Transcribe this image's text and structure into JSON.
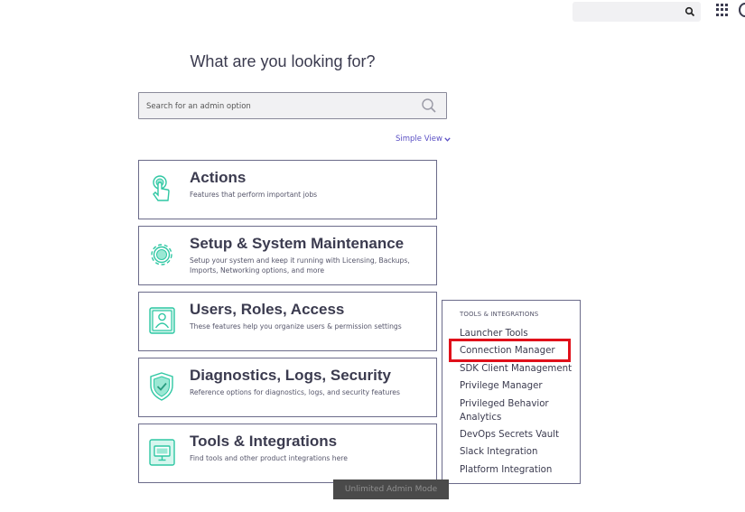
{
  "topbar": {
    "search_icon": "search-icon",
    "apps_icon": "apps-grid-icon"
  },
  "main": {
    "heading": "What are you looking for?",
    "search": {
      "placeholder": "Search for an admin option",
      "value": ""
    },
    "view_toggle": {
      "label": "Simple View"
    }
  },
  "cards": [
    {
      "title": "Actions",
      "description": "Features that perform important jobs",
      "icon": "hand-tap-icon"
    },
    {
      "title": "Setup & System Maintenance",
      "description": "Setup your system and keep it running with Licensing, Backups, Imports, Networking options, and more",
      "icon": "gear-icon"
    },
    {
      "title": "Users, Roles, Access",
      "description": "These features help you organize users & permission settings",
      "icon": "user-badge-icon"
    },
    {
      "title": "Diagnostics, Logs, Security",
      "description": "Reference options for diagnostics, logs, and security features",
      "icon": "shield-check-icon"
    },
    {
      "title": "Tools & Integrations",
      "description": "Find tools and other product integrations here",
      "icon": "monitor-icon"
    }
  ],
  "flyout": {
    "heading": "TOOLS & INTEGRATIONS",
    "items": [
      {
        "label": "Launcher Tools"
      },
      {
        "label": "Connection Manager"
      },
      {
        "label": "SDK Client Management"
      },
      {
        "label": "Privilege Manager"
      },
      {
        "label": "Privileged Behavior Analytics"
      },
      {
        "label": "DevOps Secrets Vault"
      },
      {
        "label": "Slack Integration"
      },
      {
        "label": "Platform Integration"
      }
    ]
  },
  "status": {
    "mode_badge": "Unlimited Admin Mode"
  },
  "colors": {
    "accent": "#5a4fc4",
    "icon_teal": "#2fc7a3",
    "highlight": "#e0101a",
    "border": "#6b6b8a"
  }
}
